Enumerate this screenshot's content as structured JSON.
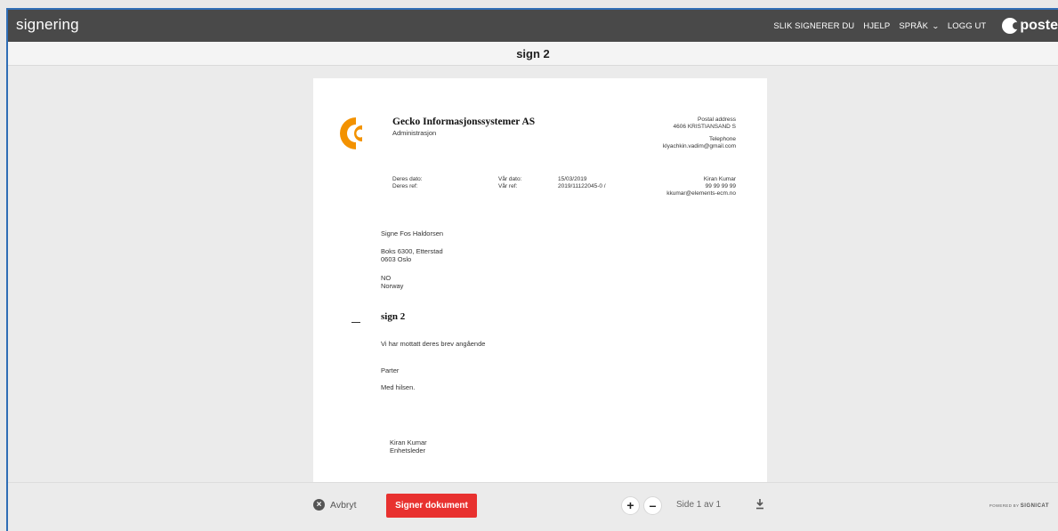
{
  "header": {
    "brand": "signering",
    "nav": {
      "how_to_sign": "SLIK SIGNERER DU",
      "help": "HJELP",
      "language": "SPRÅK",
      "logout": "LOGG UT"
    },
    "logo_text": "poste"
  },
  "document_title": "sign 2",
  "letter": {
    "company_name": "Gecko Informasjonssystemer AS",
    "company_dept": "Administrasjon",
    "postal_label": "Postal address",
    "postal_value": "4606  KRISTIANSAND S",
    "telephone_label": "Telephone",
    "telephone_value": "klyachkin.vadim@gmail.com",
    "deres_dato_label": "Deres dato:",
    "deres_ref_label": "Deres ref:",
    "var_dato_label": "Vår dato:",
    "var_ref_label": "Vår ref:",
    "var_dato_value": "15/03/2019",
    "var_ref_value": "2019/11122045-0 /",
    "contact_name": "Kiran Kumar",
    "contact_phone": "99 99 99 99",
    "contact_email": "kkumar@elements-ecm.no",
    "recipient_name": "Signe Fos Haldorsen",
    "recipient_street": "Boks 6300, Etterstad",
    "recipient_city": "0603  Oslo",
    "recipient_country_code": "NO",
    "recipient_country": "Norway",
    "subject": "sign 2",
    "body_line": "Vi har mottatt deres brev angående",
    "parter": "Parter",
    "closing": "Med hilsen.",
    "signer_name": "Kiran Kumar",
    "signer_title": "Enhetsleder"
  },
  "footer": {
    "cancel_label": "Avbryt",
    "sign_label": "Signer dokument",
    "zoom_in": "+",
    "zoom_out": "–",
    "page_indicator": "Side 1 av 1",
    "powered_by": "POWERED BY",
    "powered_brand": "SIGNICAT"
  },
  "colors": {
    "topbar": "#494949",
    "sign_button": "#e8312f",
    "logo_orange": "#f39200"
  }
}
